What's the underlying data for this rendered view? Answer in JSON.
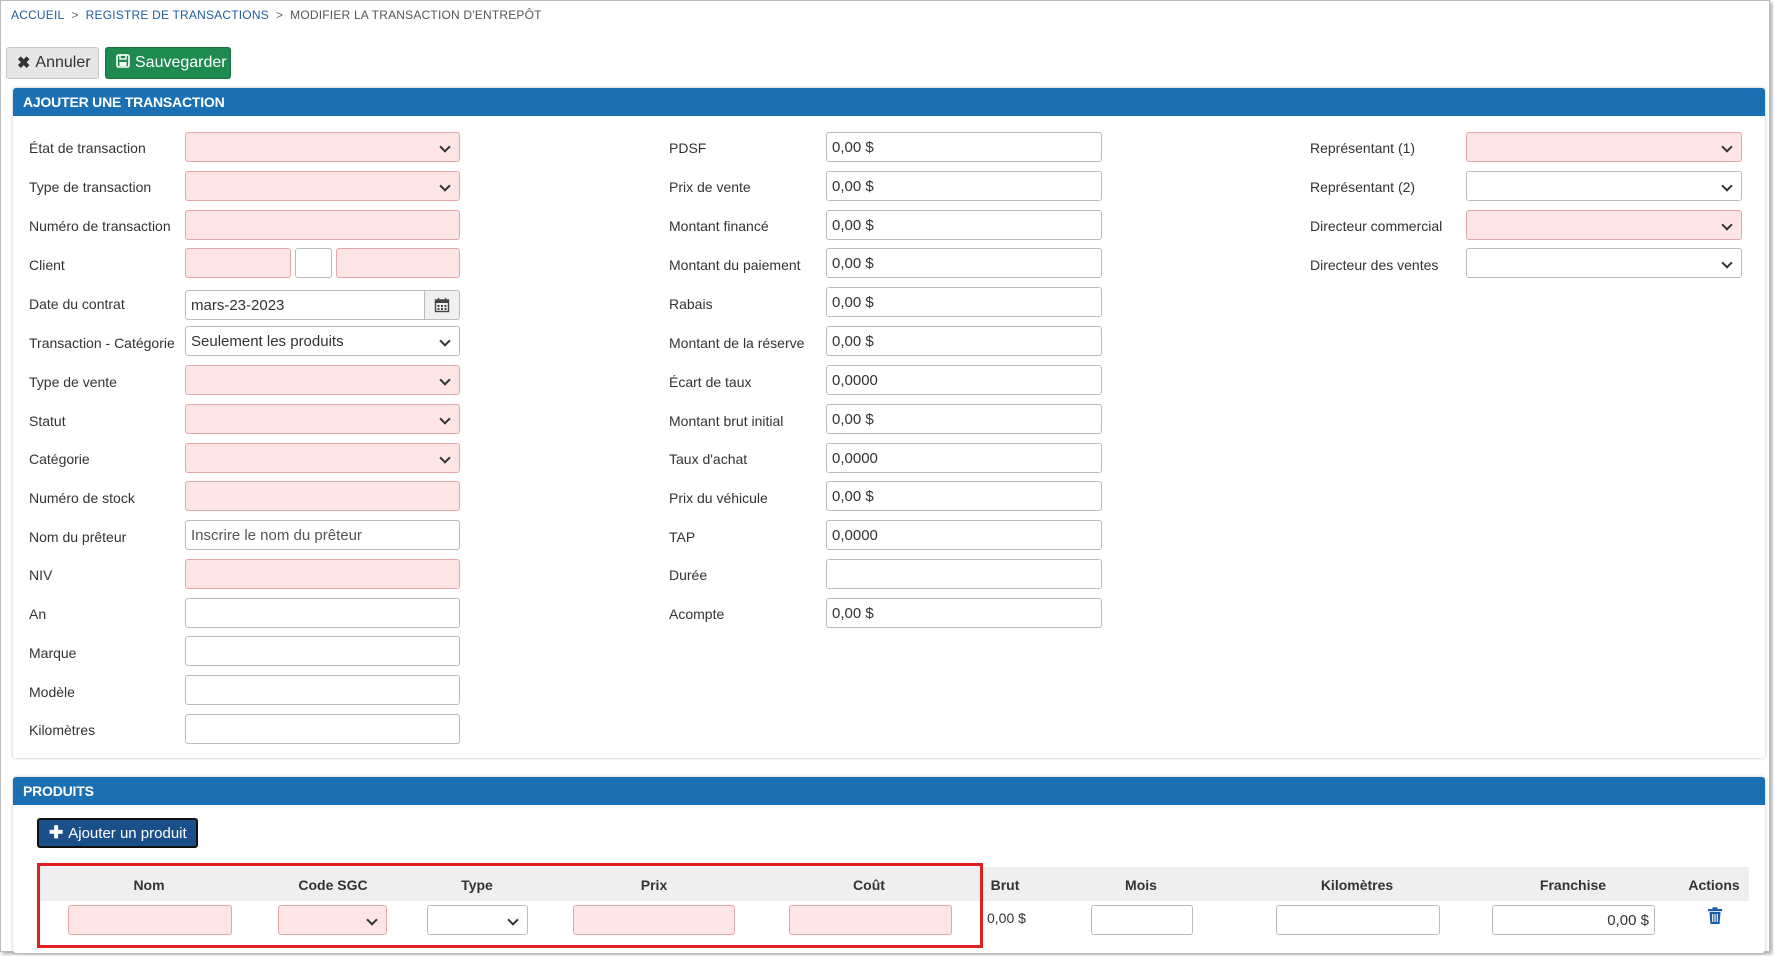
{
  "breadcrumb": {
    "home": "ACCUEIL",
    "registry": "REGISTRE DE TRANSACTIONS",
    "current": "MODIFIER LA TRANSACTION D'ENTREPÔT",
    "separator": ">"
  },
  "toolbar": {
    "cancel_label": "Annuler",
    "save_label": "Sauvegarder"
  },
  "transaction": {
    "title": "AJOUTER UNE TRANSACTION",
    "left": {
      "etat": "État de transaction",
      "type": "Type de transaction",
      "numero": "Numéro de transaction",
      "client": "Client",
      "date_label": "Date du contrat",
      "date_value": "mars-23-2023",
      "categorie_tx": "Transaction - Catégorie",
      "categorie_tx_value": "Seulement les produits",
      "type_vente": "Type de vente",
      "statut": "Statut",
      "categorie": "Catégorie",
      "stock": "Numéro de stock",
      "preteur": "Nom du prêteur",
      "preteur_placeholder": "Inscrire le nom du prêteur",
      "niv": "NIV",
      "an": "An",
      "marque": "Marque",
      "modele": "Modèle",
      "km": "Kilomètres"
    },
    "middle": {
      "pdsf": "PDSF",
      "pdsf_value": "0,00 $",
      "prix_vente": "Prix de vente",
      "prix_vente_value": "0,00 $",
      "finance": "Montant financé",
      "finance_value": "0,00 $",
      "paiement": "Montant du paiement",
      "paiement_value": "0,00 $",
      "rabais": "Rabais",
      "rabais_value": "0,00 $",
      "reserve": "Montant de la réserve",
      "reserve_value": "0,00 $",
      "ecart": "Écart de taux",
      "ecart_value": "0,0000",
      "brut_initial": "Montant brut initial",
      "brut_initial_value": "0,00 $",
      "taux_achat": "Taux d'achat",
      "taux_achat_value": "0,0000",
      "prix_vehicule": "Prix du véhicule",
      "prix_vehicule_value": "0,00 $",
      "tap": "TAP",
      "tap_value": "0,0000",
      "duree": "Durée",
      "acompte": "Acompte",
      "acompte_value": "0,00 $"
    },
    "right": {
      "rep1": "Représentant (1)",
      "rep2": "Représentant (2)",
      "dir_commercial": "Directeur commercial",
      "dir_ventes": "Directeur des ventes"
    }
  },
  "products": {
    "title": "PRODUITS",
    "add_label": "Ajouter un produit",
    "columns": {
      "nom": "Nom",
      "code": "Code SGC",
      "type": "Type",
      "prix": "Prix",
      "cout": "Coût",
      "brut": "Brut",
      "mois": "Mois",
      "km": "Kilomètres",
      "franchise": "Franchise",
      "actions": "Actions"
    },
    "row": {
      "brut": "0,00 $",
      "franchise": "0,00 $"
    }
  },
  "colors": {
    "header": "#1b6fb3",
    "save": "#1e8a4f",
    "required": "#fde5e5",
    "highlight": "#e02020"
  },
  "icons": [
    "times-icon",
    "save-icon",
    "calendar-icon",
    "plus-icon",
    "trash-icon",
    "chevron-down-icon"
  ]
}
